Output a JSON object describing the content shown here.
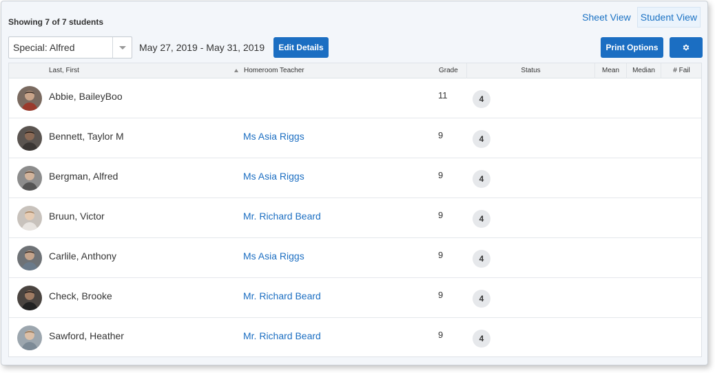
{
  "header": {
    "showing_text": "Showing 7 of 7 students",
    "views": {
      "sheet": "Sheet View",
      "student": "Student View",
      "active": "student"
    }
  },
  "toolbar": {
    "filter_value": "Special: Alfred",
    "date_range": "May 27, 2019 - May 31, 2019",
    "edit_details_label": "Edit Details",
    "print_options_label": "Print Options",
    "settings_icon": "gear-icon"
  },
  "table": {
    "columns": {
      "name": "Last, First",
      "teacher": "Homeroom Teacher",
      "grade": "Grade",
      "status": "Status",
      "mean": "Mean",
      "median": "Median",
      "fail": "# Fail"
    },
    "rows": [
      {
        "name": "Abbie, BaileyBoo",
        "teacher": "",
        "grade": "11",
        "status": "4"
      },
      {
        "name": "Bennett, Taylor M",
        "teacher": "Ms Asia Riggs",
        "grade": "9",
        "status": "4"
      },
      {
        "name": "Bergman, Alfred",
        "teacher": "Ms Asia Riggs",
        "grade": "9",
        "status": "4"
      },
      {
        "name": "Bruun, Victor",
        "teacher": "Mr. Richard Beard",
        "grade": "9",
        "status": "4"
      },
      {
        "name": "Carlile, Anthony",
        "teacher": "Ms Asia Riggs",
        "grade": "9",
        "status": "4"
      },
      {
        "name": "Check, Brooke",
        "teacher": "Mr. Richard Beard",
        "grade": "9",
        "status": "4"
      },
      {
        "name": "Sawford, Heather",
        "teacher": "Mr. Richard Beard",
        "grade": "9",
        "status": "4"
      }
    ]
  },
  "colors": {
    "primary": "#1b6ec2",
    "link": "#1b6ec2",
    "panel_bg": "#f3f6fa",
    "badge_bg": "#e6e8eb"
  }
}
